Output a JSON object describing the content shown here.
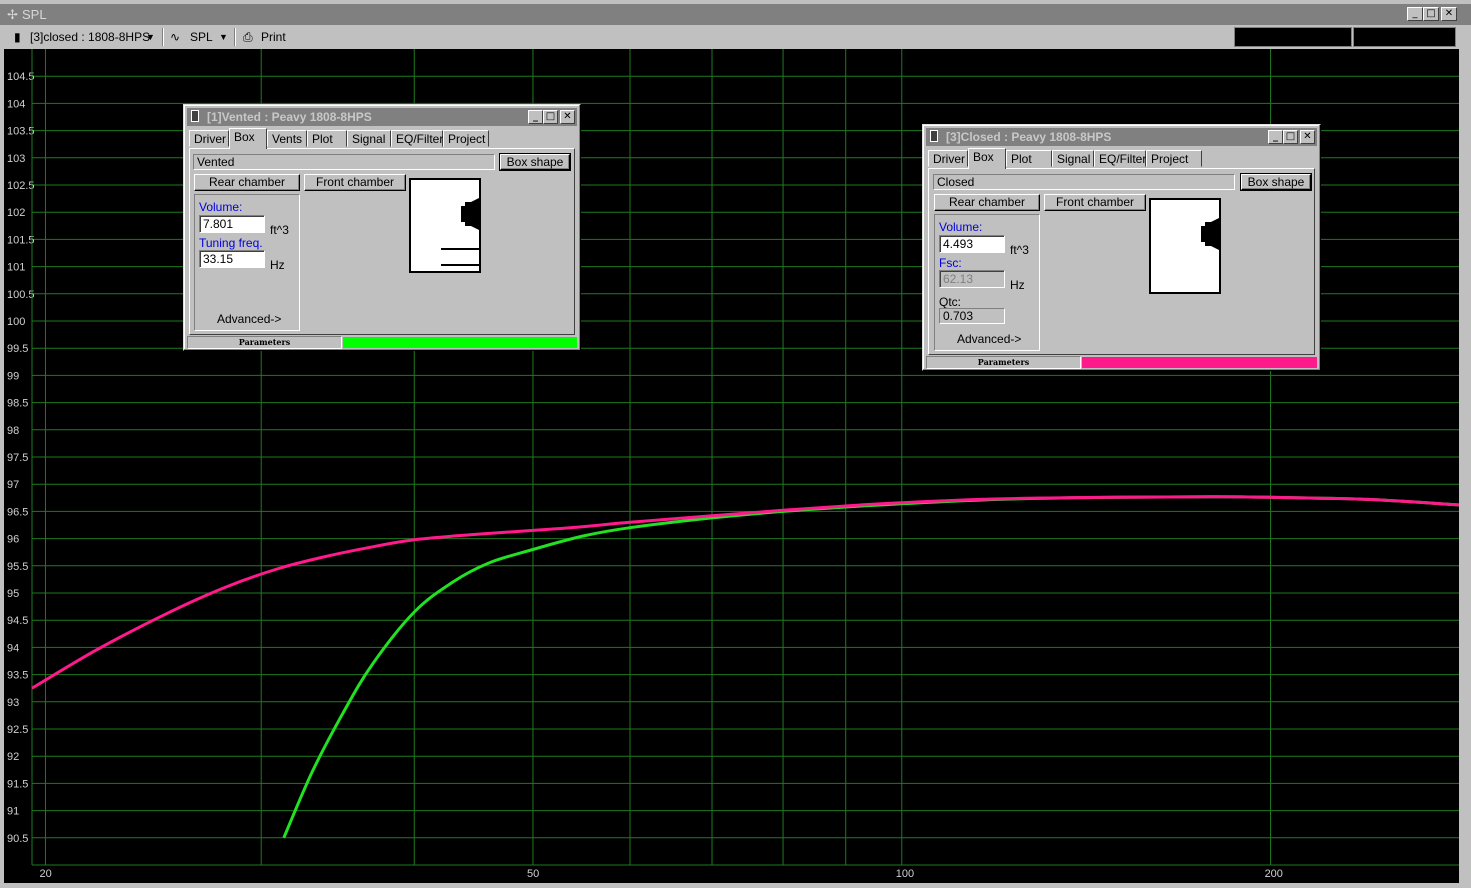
{
  "window": {
    "title": "SPL"
  },
  "toolbar": {
    "project_select": "[3]closed : 1808-8HPS",
    "plot_select": "SPL",
    "print_label": "Print"
  },
  "chart_data": {
    "type": "line",
    "title": "",
    "xscale": "log",
    "xlim": [
      19.5,
      285
    ],
    "ylim": [
      90,
      105
    ],
    "x_ticks": [
      20,
      50,
      100,
      200
    ],
    "y_ticks": [
      90.5,
      91,
      91.5,
      92,
      92.5,
      93,
      93.5,
      94,
      94.5,
      95,
      95.5,
      96,
      96.5,
      97,
      97.5,
      98,
      98.5,
      99,
      99.5,
      100,
      100.5,
      101,
      101.5,
      102,
      102.5,
      103,
      103.5,
      104,
      104.5
    ],
    "grid": true,
    "series": [
      {
        "color": "#ff1a8c",
        "x": [
          19.5,
          22,
          25,
          28,
          31,
          34,
          37,
          40,
          45,
          50,
          55,
          60,
          70,
          80,
          90,
          100,
          120,
          150,
          180,
          200,
          240,
          285
        ],
        "y": [
          93.25,
          93.95,
          94.6,
          95.1,
          95.45,
          95.68,
          95.85,
          95.98,
          96.08,
          96.15,
          96.22,
          96.3,
          96.42,
          96.52,
          96.6,
          96.66,
          96.73,
          96.76,
          96.77,
          96.76,
          96.72,
          96.62
        ]
      },
      {
        "color": "#22e022",
        "x": [
          31.3,
          33,
          35,
          37,
          40,
          43,
          46,
          50,
          55,
          60,
          70,
          80,
          90,
          100,
          120,
          150,
          180,
          200,
          240,
          285
        ],
        "y": [
          90.5,
          91.7,
          92.8,
          93.7,
          94.65,
          95.2,
          95.55,
          95.8,
          96.05,
          96.2,
          96.38,
          96.5,
          96.58,
          96.64,
          96.72,
          96.76,
          96.77,
          96.76,
          96.72,
          96.62
        ]
      }
    ]
  },
  "vented_panel": {
    "title": "[1]Vented : Peavy 1808-8HPS",
    "tabs": [
      "Driver",
      "Box",
      "Vents",
      "Plot",
      "Signal",
      "EQ/Filter",
      "Project"
    ],
    "box_type": "Vented",
    "box_shape_btn": "Box shape",
    "rear_chamber_btn": "Rear chamber",
    "front_chamber_btn": "Front chamber",
    "volume_label": "Volume:",
    "volume_value": "7.801",
    "volume_unit": "ft^3",
    "tuning_label": "Tuning freq.",
    "tuning_value": "33.15",
    "tuning_unit": "Hz",
    "advanced": "Advanced->",
    "status_label": "Parameters",
    "accent": "#00ff00"
  },
  "closed_panel": {
    "title": "[3]Closed : Peavy 1808-8HPS",
    "tabs": [
      "Driver",
      "Box",
      "Plot",
      "Signal",
      "EQ/Filter",
      "Project"
    ],
    "box_type": "Closed",
    "box_shape_btn": "Box shape",
    "rear_chamber_btn": "Rear chamber",
    "front_chamber_btn": "Front chamber",
    "volume_label": "Volume:",
    "volume_value": "4.493",
    "volume_unit": "ft^3",
    "fsc_label": "Fsc:",
    "fsc_value": "62.13",
    "fsc_unit": "Hz",
    "qtc_label": "Qtc:",
    "qtc_value": "0.703",
    "advanced": "Advanced->",
    "status_label": "Parameters",
    "accent": "#ff1a8c"
  },
  "icons": {
    "app": "crosshair-icon",
    "driver": "speaker-icon",
    "wave": "wave-icon",
    "print": "printer-icon"
  }
}
